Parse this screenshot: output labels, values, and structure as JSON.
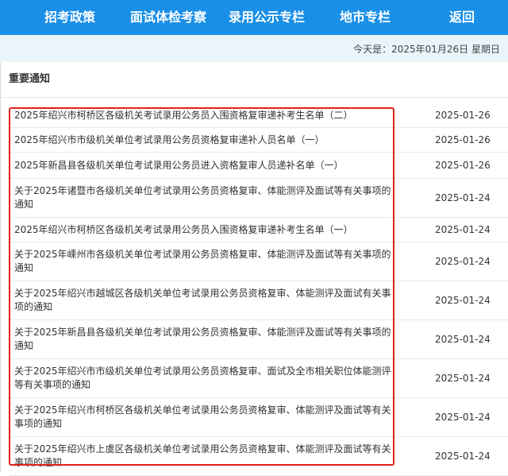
{
  "nav": {
    "items": [
      {
        "label": "招考政策"
      },
      {
        "label": "面试体检考察"
      },
      {
        "label": "录用公示专栏"
      },
      {
        "label": "地市专栏"
      },
      {
        "label": "返回"
      }
    ]
  },
  "datebar": {
    "text": "今天是：2025年01月26日 星期日"
  },
  "section": {
    "title": "重要通知"
  },
  "notices": [
    {
      "title": "2025年绍兴市柯桥区各级机关考试录用公务员入围资格复审递补考生名单（二）",
      "date": "2025-01-26"
    },
    {
      "title": "2025年绍兴市市级机关单位考试录用公务员资格复审递补人员名单（一）",
      "date": "2025-01-26"
    },
    {
      "title": "2025年新昌县各级机关单位考试录用公务员进入资格复审人员递补名单（一）",
      "date": "2025-01-26"
    },
    {
      "title": "关于2025年诸暨市各级机关单位考试录用公务员资格复审、体能测评及面试等有关事项的通知",
      "date": "2025-01-24"
    },
    {
      "title": "2025年绍兴市柯桥区各级机关考试录用公务员入围资格复审递补考生名单（一）",
      "date": "2025-01-24"
    },
    {
      "title": "关于2025年嵊州市各级机关单位考试录用公务员资格复审、体能测评及面试等有关事项的通知",
      "date": "2025-01-24"
    },
    {
      "title": "关于2025年绍兴市越城区各级机关单位考试录用公务员资格复审、体能测评及面试有关事项的通知",
      "date": "2025-01-24"
    },
    {
      "title": "关于2025年新昌县各级机关单位考试录用公务员资格复审、体能测评及面试等有关事项的通知",
      "date": "2025-01-24"
    },
    {
      "title": "关于2025年绍兴市市级机关单位考试录用公务员资格复审、面试及全市相关职位体能测评等有关事项的通知",
      "date": "2025-01-24"
    },
    {
      "title": "关于2025年绍兴市柯桥区各级机关单位考试录用公务员资格复审、体能测评及面试等有关事项的通知",
      "date": "2025-01-24"
    },
    {
      "title": "关于2025年绍兴市上虞区各级机关单位考试录用公务员资格复审、体能测评及面试等有关事项的通知",
      "date": "2025-01-24"
    }
  ]
}
